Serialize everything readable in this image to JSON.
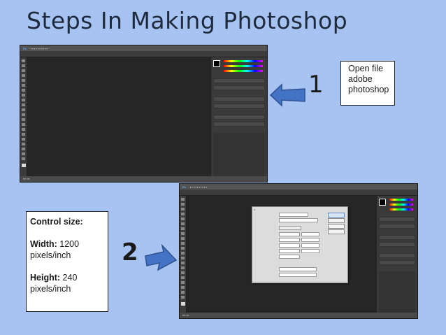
{
  "slide": {
    "title": "Steps In Making Photoshop"
  },
  "step1": {
    "number": "1",
    "callout_lines": [
      "Open file",
      "adobe",
      "photoshop"
    ]
  },
  "step2": {
    "number": "2",
    "callout": {
      "heading": "Control size:",
      "width_label": "Width:",
      "width_value": "1200",
      "width_unit": "pixels/inch",
      "height_label": "Height:",
      "height_value": "240",
      "height_unit": "pixels/inch"
    }
  },
  "colors": {
    "background": "#a6c3f2",
    "arrow_fill": "#4472c4",
    "arrow_stroke": "#2f528f",
    "photoshop_dark": "#282828"
  }
}
